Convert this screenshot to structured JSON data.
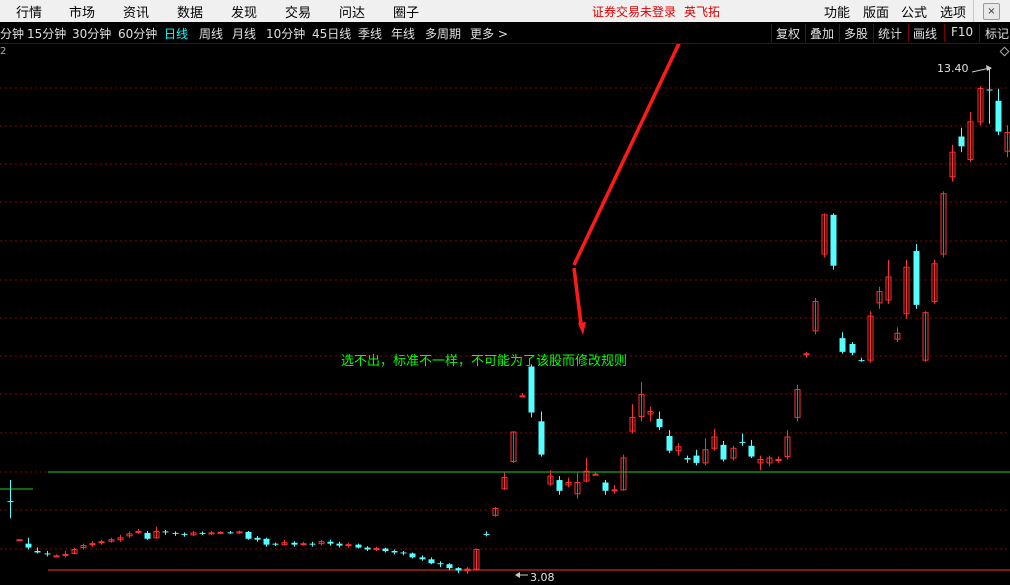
{
  "menu": {
    "items": [
      {
        "label": "行情",
        "name": "menu-hangqing"
      },
      {
        "label": "市场",
        "name": "menu-shichang"
      },
      {
        "label": "资讯",
        "name": "menu-zixun"
      },
      {
        "label": "数据",
        "name": "menu-shuju"
      },
      {
        "label": "发现",
        "name": "menu-faxian"
      },
      {
        "label": "交易",
        "name": "menu-jiaoyi"
      },
      {
        "label": "问达",
        "name": "menu-wenda"
      },
      {
        "label": "圈子",
        "name": "menu-quanzi"
      }
    ],
    "status_notice": "证券交易未登录",
    "brand": "英飞拓",
    "right_tools": [
      "功能",
      "版面",
      "公式",
      "选项"
    ],
    "close_glyph": "×"
  },
  "periods": {
    "items": [
      "分钟",
      "15分钟",
      "30分钟",
      "60分钟",
      "日线",
      "周线",
      "月线",
      "10分钟",
      "45日线",
      "季线",
      "年线",
      "多周期",
      "更多 >"
    ],
    "active": "日线",
    "tools": [
      "复权",
      "叠加",
      "多股",
      "统计",
      "画线",
      "F10",
      "标记"
    ]
  },
  "chart": {
    "price_high_label": "13.40",
    "price_low_label": "3.08",
    "partial_prefix": "2",
    "annotation": "选不出，标准不一样，不可能为了该股而修改规则",
    "colors": {
      "bg": "#000000",
      "up": "#ff3030",
      "down": "#54ffff",
      "grid": "#8b0000",
      "support_line": "#22cc22",
      "arrow": "#ff1a1a",
      "annotation": "#00ff00"
    }
  },
  "chart_data": {
    "type": "candlestick",
    "high": 13.4,
    "low": 3.08,
    "candles": [
      [
        4.57,
        4.57,
        5.0,
        4.22,
        "d"
      ],
      [
        3.78,
        3.78,
        3.78,
        3.78,
        "u"
      ],
      [
        3.7,
        3.62,
        3.82,
        3.58,
        "d"
      ],
      [
        3.55,
        3.52,
        3.62,
        3.5,
        "d"
      ],
      [
        3.5,
        3.48,
        3.55,
        3.44,
        "d"
      ],
      [
        3.45,
        3.45,
        3.48,
        3.42,
        "u"
      ],
      [
        3.47,
        3.48,
        3.55,
        3.42,
        "u"
      ],
      [
        3.5,
        3.58,
        3.62,
        3.48,
        "u"
      ],
      [
        3.62,
        3.66,
        3.7,
        3.58,
        "u"
      ],
      [
        3.68,
        3.7,
        3.75,
        3.64,
        "u"
      ],
      [
        3.72,
        3.74,
        3.78,
        3.68,
        "u"
      ],
      [
        3.75,
        3.78,
        3.82,
        3.72,
        "u"
      ],
      [
        3.78,
        3.82,
        3.88,
        3.74,
        "u"
      ],
      [
        3.86,
        3.9,
        3.95,
        3.82,
        "u"
      ],
      [
        3.95,
        3.94,
        4.0,
        3.9,
        "u"
      ],
      [
        3.92,
        3.8,
        3.96,
        3.78,
        "d"
      ],
      [
        3.82,
        3.95,
        4.05,
        3.8,
        "u"
      ],
      [
        3.95,
        3.94,
        3.98,
        3.88,
        "d"
      ],
      [
        3.92,
        3.9,
        3.95,
        3.86,
        "d"
      ],
      [
        3.9,
        3.88,
        3.93,
        3.84,
        "d"
      ],
      [
        3.88,
        3.92,
        3.96,
        3.85,
        "u"
      ],
      [
        3.92,
        3.9,
        3.95,
        3.88,
        "d"
      ],
      [
        3.9,
        3.92,
        3.96,
        3.88,
        "u"
      ],
      [
        3.92,
        3.93,
        3.96,
        3.9,
        "u"
      ],
      [
        3.93,
        3.92,
        3.96,
        3.9,
        "d"
      ],
      [
        3.93,
        3.94,
        3.97,
        3.9,
        "u"
      ],
      [
        3.94,
        3.8,
        3.96,
        3.78,
        "d"
      ],
      [
        3.82,
        3.78,
        3.86,
        3.74,
        "d"
      ],
      [
        3.8,
        3.68,
        3.82,
        3.64,
        "d"
      ],
      [
        3.7,
        3.68,
        3.72,
        3.65,
        "d"
      ],
      [
        3.68,
        3.72,
        3.78,
        3.66,
        "u"
      ],
      [
        3.72,
        3.68,
        3.75,
        3.64,
        "d"
      ],
      [
        3.68,
        3.7,
        3.74,
        3.66,
        "u"
      ],
      [
        3.7,
        3.68,
        3.74,
        3.64,
        "d"
      ],
      [
        3.7,
        3.74,
        3.78,
        3.66,
        "u"
      ],
      [
        3.74,
        3.7,
        3.78,
        3.66,
        "d"
      ],
      [
        3.7,
        3.66,
        3.74,
        3.62,
        "d"
      ],
      [
        3.66,
        3.68,
        3.72,
        3.62,
        "u"
      ],
      [
        3.68,
        3.62,
        3.7,
        3.6,
        "d"
      ],
      [
        3.62,
        3.58,
        3.65,
        3.55,
        "d"
      ],
      [
        3.58,
        3.6,
        3.64,
        3.55,
        "u"
      ],
      [
        3.6,
        3.55,
        3.62,
        3.52,
        "d"
      ],
      [
        3.55,
        3.52,
        3.58,
        3.48,
        "d"
      ],
      [
        3.52,
        3.5,
        3.55,
        3.46,
        "d"
      ],
      [
        3.5,
        3.42,
        3.52,
        3.4,
        "d"
      ],
      [
        3.42,
        3.38,
        3.46,
        3.35,
        "d"
      ],
      [
        3.38,
        3.3,
        3.42,
        3.28,
        "d"
      ],
      [
        3.3,
        3.28,
        3.34,
        3.22,
        "d"
      ],
      [
        3.28,
        3.2,
        3.3,
        3.16,
        "d"
      ],
      [
        3.2,
        3.15,
        3.22,
        3.1,
        "d"
      ],
      [
        3.15,
        3.18,
        3.22,
        3.08,
        "u"
      ],
      [
        3.18,
        3.58,
        3.6,
        3.15,
        "u"
      ],
      [
        3.9,
        3.9,
        3.95,
        3.85,
        "d"
      ],
      [
        4.28,
        4.42,
        4.45,
        4.25,
        "u"
      ],
      [
        4.82,
        5.05,
        5.15,
        4.8,
        "u"
      ],
      [
        5.38,
        5.98,
        6.0,
        5.35,
        "u"
      ],
      [
        6.72,
        6.72,
        6.78,
        6.72,
        "u"
      ],
      [
        7.32,
        6.38,
        7.36,
        6.28,
        "d"
      ],
      [
        6.2,
        5.52,
        6.4,
        5.48,
        "d"
      ],
      [
        5.08,
        4.92,
        5.2,
        4.88,
        "u"
      ],
      [
        5.0,
        4.78,
        5.08,
        4.7,
        "d"
      ],
      [
        4.9,
        4.95,
        5.05,
        4.85,
        "u"
      ],
      [
        4.72,
        4.95,
        5.15,
        4.62,
        "u"
      ],
      [
        4.98,
        5.18,
        5.45,
        4.95,
        "u"
      ],
      [
        5.12,
        5.12,
        5.15,
        5.1,
        "u"
      ],
      [
        4.95,
        4.78,
        5.0,
        4.7,
        "d"
      ],
      [
        4.78,
        4.8,
        4.9,
        4.72,
        "u"
      ],
      [
        4.8,
        5.45,
        5.52,
        4.78,
        "u"
      ],
      [
        6.0,
        6.28,
        6.55,
        5.95,
        "u"
      ],
      [
        6.3,
        6.75,
        7.0,
        6.2,
        "u"
      ],
      [
        6.35,
        6.4,
        6.5,
        6.2,
        "u"
      ],
      [
        6.25,
        6.08,
        6.4,
        6.02,
        "d"
      ],
      [
        5.9,
        5.6,
        6.02,
        5.55,
        "d"
      ],
      [
        5.6,
        5.68,
        5.75,
        5.5,
        "u"
      ],
      [
        5.45,
        5.42,
        5.5,
        5.35,
        "d"
      ],
      [
        5.5,
        5.35,
        5.62,
        5.3,
        "d"
      ],
      [
        5.35,
        5.62,
        5.85,
        5.3,
        "u"
      ],
      [
        5.65,
        5.88,
        6.05,
        5.6,
        "u"
      ],
      [
        5.72,
        5.42,
        5.8,
        5.38,
        "d"
      ],
      [
        5.45,
        5.65,
        5.7,
        5.4,
        "u"
      ],
      [
        5.78,
        5.78,
        5.95,
        5.7,
        "d"
      ],
      [
        5.7,
        5.48,
        5.82,
        5.45,
        "d"
      ],
      [
        5.35,
        5.42,
        5.5,
        5.2,
        "u"
      ],
      [
        5.35,
        5.45,
        5.5,
        5.28,
        "u"
      ],
      [
        5.4,
        5.42,
        5.48,
        5.35,
        "u"
      ],
      [
        5.48,
        5.88,
        6.02,
        5.42,
        "u"
      ],
      [
        6.28,
        6.85,
        6.95,
        6.2,
        "u"
      ],
      [
        7.58,
        7.58,
        7.62,
        7.5,
        "u"
      ],
      [
        8.05,
        8.65,
        8.72,
        7.98,
        "u"
      ],
      [
        9.62,
        10.42,
        10.45,
        9.55,
        "u"
      ],
      [
        10.42,
        9.38,
        10.45,
        9.3,
        "d"
      ],
      [
        7.9,
        7.62,
        8.02,
        7.58,
        "d"
      ],
      [
        7.78,
        7.6,
        7.82,
        7.55,
        "d"
      ],
      [
        7.45,
        7.45,
        7.5,
        7.42,
        "d"
      ],
      [
        7.45,
        8.35,
        8.45,
        7.4,
        "u"
      ],
      [
        8.62,
        8.85,
        8.95,
        8.5,
        "u"
      ],
      [
        8.68,
        9.15,
        9.5,
        8.6,
        "u"
      ],
      [
        7.88,
        8.0,
        8.12,
        7.82,
        "u"
      ],
      [
        8.4,
        9.35,
        9.5,
        8.3,
        "u"
      ],
      [
        9.68,
        8.58,
        9.82,
        8.5,
        "d"
      ],
      [
        7.45,
        8.42,
        8.45,
        7.42,
        "u"
      ],
      [
        8.65,
        9.42,
        9.5,
        8.6,
        "u"
      ],
      [
        9.62,
        10.85,
        10.9,
        9.55,
        "u"
      ],
      [
        11.2,
        11.7,
        11.85,
        11.1,
        "u"
      ],
      [
        12.02,
        11.82,
        12.2,
        11.7,
        "d"
      ],
      [
        11.55,
        12.32,
        12.52,
        11.5,
        "u"
      ],
      [
        12.32,
        13.0,
        13.05,
        12.25,
        "u"
      ],
      [
        12.98,
        12.98,
        13.4,
        12.28,
        "d"
      ],
      [
        12.75,
        12.12,
        13.0,
        12.05,
        "d"
      ],
      [
        11.72,
        12.1,
        12.25,
        11.6,
        "u"
      ]
    ]
  }
}
